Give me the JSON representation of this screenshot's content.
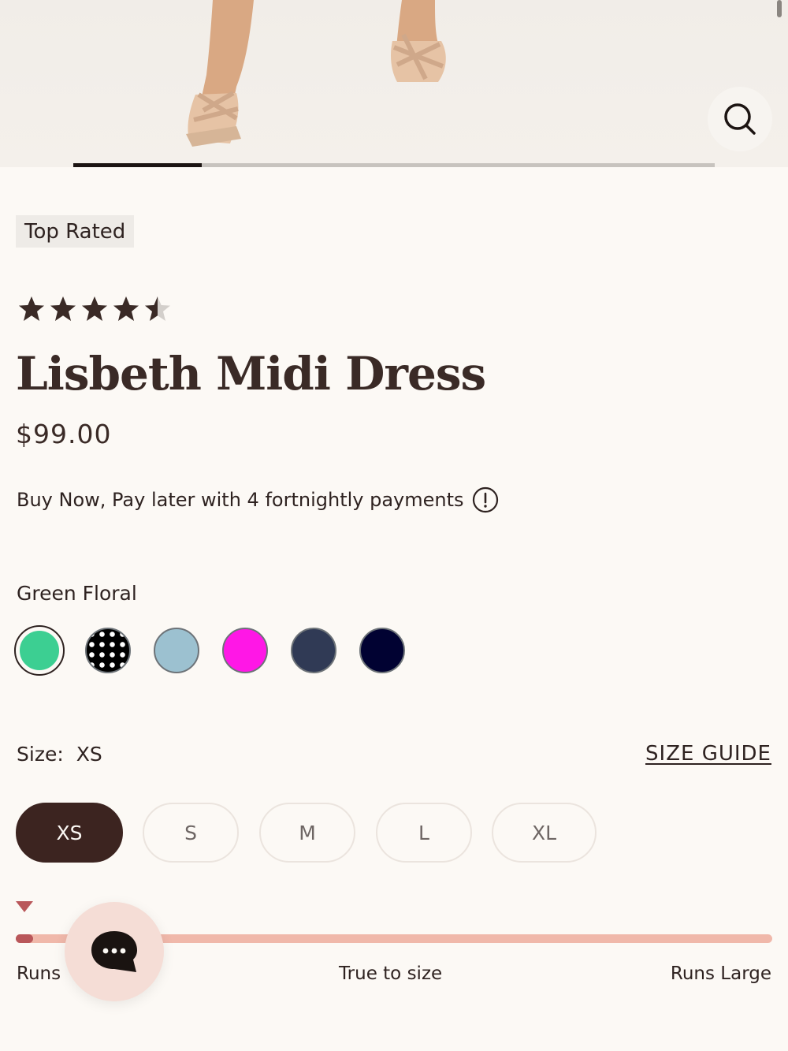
{
  "hero": {
    "zoom_icon": "magnifier-icon",
    "carousel_progress": 0.2
  },
  "badge": "Top Rated",
  "rating": {
    "value": 4.5,
    "max": 5
  },
  "product": {
    "title": "Lisbeth Midi Dress",
    "price": "$99.00",
    "bnpl_text": "Buy Now, Pay later with 4 fortnightly payments",
    "info_icon": "info-icon"
  },
  "color": {
    "selected_name": "Green Floral",
    "swatches": [
      {
        "color": "#3ccf92",
        "pattern": "solid",
        "selected": true
      },
      {
        "color": "#000000",
        "pattern": "dots"
      },
      {
        "color": "#9cc1d0",
        "pattern": "solid"
      },
      {
        "color": "#ff17e6",
        "pattern": "solid"
      },
      {
        "color": "#303a55",
        "pattern": "solid"
      },
      {
        "color": "#010232",
        "pattern": "solid"
      }
    ]
  },
  "size": {
    "label": "Size:",
    "selected": "XS",
    "guide": "SIZE GUIDE",
    "options": [
      "XS",
      "S",
      "M",
      "L",
      "XL"
    ]
  },
  "fit": {
    "left": "Runs",
    "center": "True to size",
    "right": "Runs Large",
    "position": 0.0
  },
  "chat": {
    "icon": "chat-bubble-icon"
  },
  "colors": {
    "accent": "#3c2420",
    "fit_marker": "#b9575a",
    "fit_track": "#f0b8aa"
  }
}
